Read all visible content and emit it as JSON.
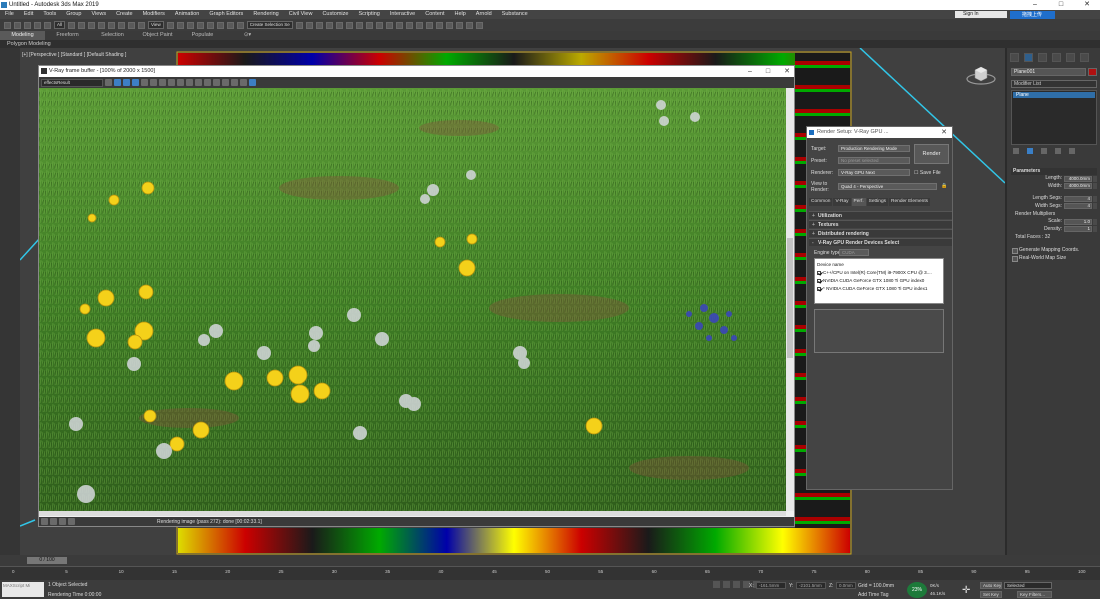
{
  "app": {
    "title": "Untitled - Autodesk 3ds Max 2019",
    "signin_label": "Sign In",
    "cloud_label": "拖拽上传"
  },
  "menu": [
    "File",
    "Edit",
    "Tools",
    "Group",
    "Views",
    "Create",
    "Modifiers",
    "Animation",
    "Graph Editors",
    "Rendering",
    "Civil View",
    "Customize",
    "Scripting",
    "Interactive",
    "Content",
    "Help",
    "Arnold",
    "Substance"
  ],
  "toolbar": {
    "filter": "All",
    "view": "View",
    "selection_set": "Create Selection Se"
  },
  "ribbon": {
    "tabs": [
      "Modeling",
      "Freeform",
      "Selection",
      "Object Paint",
      "Populate"
    ],
    "sub_label": "Polygon Modeling"
  },
  "viewport": {
    "label": "[+] [Perspective ] [Standard ] [Default Shading ]"
  },
  "vfb": {
    "title": "V-Ray frame buffer - [100% of 2000 x 1500]",
    "channel": "effectsResult",
    "status": "Rendering image (pass 272): done [00:02:33.1]"
  },
  "render_setup": {
    "title": "Render Setup: V-Ray GPU ...",
    "target_label": "Target:",
    "target_value": "Production Rendering Mode",
    "preset_label": "Preset:",
    "preset_value": "No preset selected",
    "renderer_label": "Renderer:",
    "renderer_value": "V-Ray GPU Next",
    "save_file_label": "Save File",
    "view_label": "View to Render:",
    "view_value": "Quad 4 - Perspective",
    "render_button": "Render",
    "tabs": [
      "Common",
      "V-Ray",
      "Perf.",
      "Settings",
      "Render Elements"
    ],
    "rollouts": [
      "Utilization",
      "Textures",
      "Distributed rendering",
      "V-Ray GPU Render Devices Select"
    ],
    "engine_label": "Engine type",
    "engine_value": "CUDA",
    "device_header": "Device name",
    "devices": [
      "C++/CPU on Intel(R) Core(TM) i9-7900X CPU @ 3....",
      "NVIDIA CUDA GeForce GTX 1080 Ti GPU index0",
      "* NVIDIA CUDA GeForce GTX 1080 Ti GPU index1"
    ]
  },
  "command_panel": {
    "object_name": "Plane001",
    "modifier_list": "Modifier List",
    "stack_item": "Plane",
    "params_title": "Parameters",
    "length_label": "Length:",
    "length_value": "4000.0mm",
    "width_label": "Width:",
    "width_value": "4000.0mm",
    "length_segs_label": "Length Segs:",
    "length_segs_value": "4",
    "width_segs_label": "Width Segs:",
    "width_segs_value": "4",
    "multipliers_label": "Render Multipliers",
    "scale_label": "Scale:",
    "scale_value": "1.0",
    "density_label": "Density:",
    "density_value": "1",
    "total_faces": "Total Faces : 32",
    "gen_mapping": "Generate Mapping Coords.",
    "real_world": "Real-World Map Size",
    "object_color": "#b01010"
  },
  "timeline": {
    "slider": "0 / 100",
    "ticks": [
      "0",
      "5",
      "10",
      "15",
      "20",
      "25",
      "30",
      "35",
      "40",
      "45",
      "50",
      "55",
      "60",
      "65",
      "70",
      "75",
      "80",
      "85",
      "90",
      "95",
      "100"
    ]
  },
  "status": {
    "maxscript": "MAXScript Mi",
    "objects_selected": "1 Object Selected",
    "rendering_time": "Rendering Time  0:00:00",
    "x_label": "X:",
    "x_value": "-161.5mm",
    "y_label": "Y:",
    "y_value": "-2101.5mm",
    "z_label": "Z:",
    "z_value": "0.0mm",
    "grid": "Grid = 100.0mm",
    "add_time_tag": "Add Time Tag",
    "auto_key": "Auto Key",
    "set_key": "Set Key",
    "selected": "Selected",
    "key_filters": "Key Filters...",
    "perf_percent": "23%",
    "net_up": "0K/s",
    "net_down": "46.1K/s"
  }
}
